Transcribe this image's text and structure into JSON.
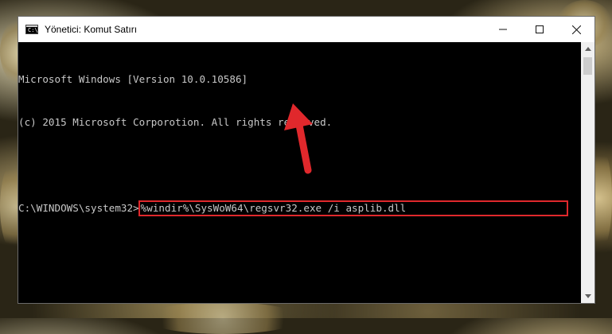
{
  "window": {
    "title": "Yönetici: Komut Satırı",
    "icon": "cmd-icon",
    "controls": [
      "minimize-icon",
      "maximize-icon",
      "close-icon"
    ]
  },
  "console": {
    "lines": [
      "Microsoft Windows [Version 10.0.10586]",
      "(c) 2015 Microsoft Corporotion. All rights reserved.",
      ""
    ],
    "prompt": "C:\\WINDOWS\\system32>",
    "command": "%windir%\\SysWoW64\\regsvr32.exe /i asplib.dll"
  },
  "annotation": {
    "highlight_color": "#e0282c",
    "arrow_color": "#e0282c",
    "arrow_icon": "red-arrow-icon"
  },
  "scrollbar": {
    "up_icon": "scroll-up-icon",
    "down_icon": "scroll-down-icon"
  }
}
